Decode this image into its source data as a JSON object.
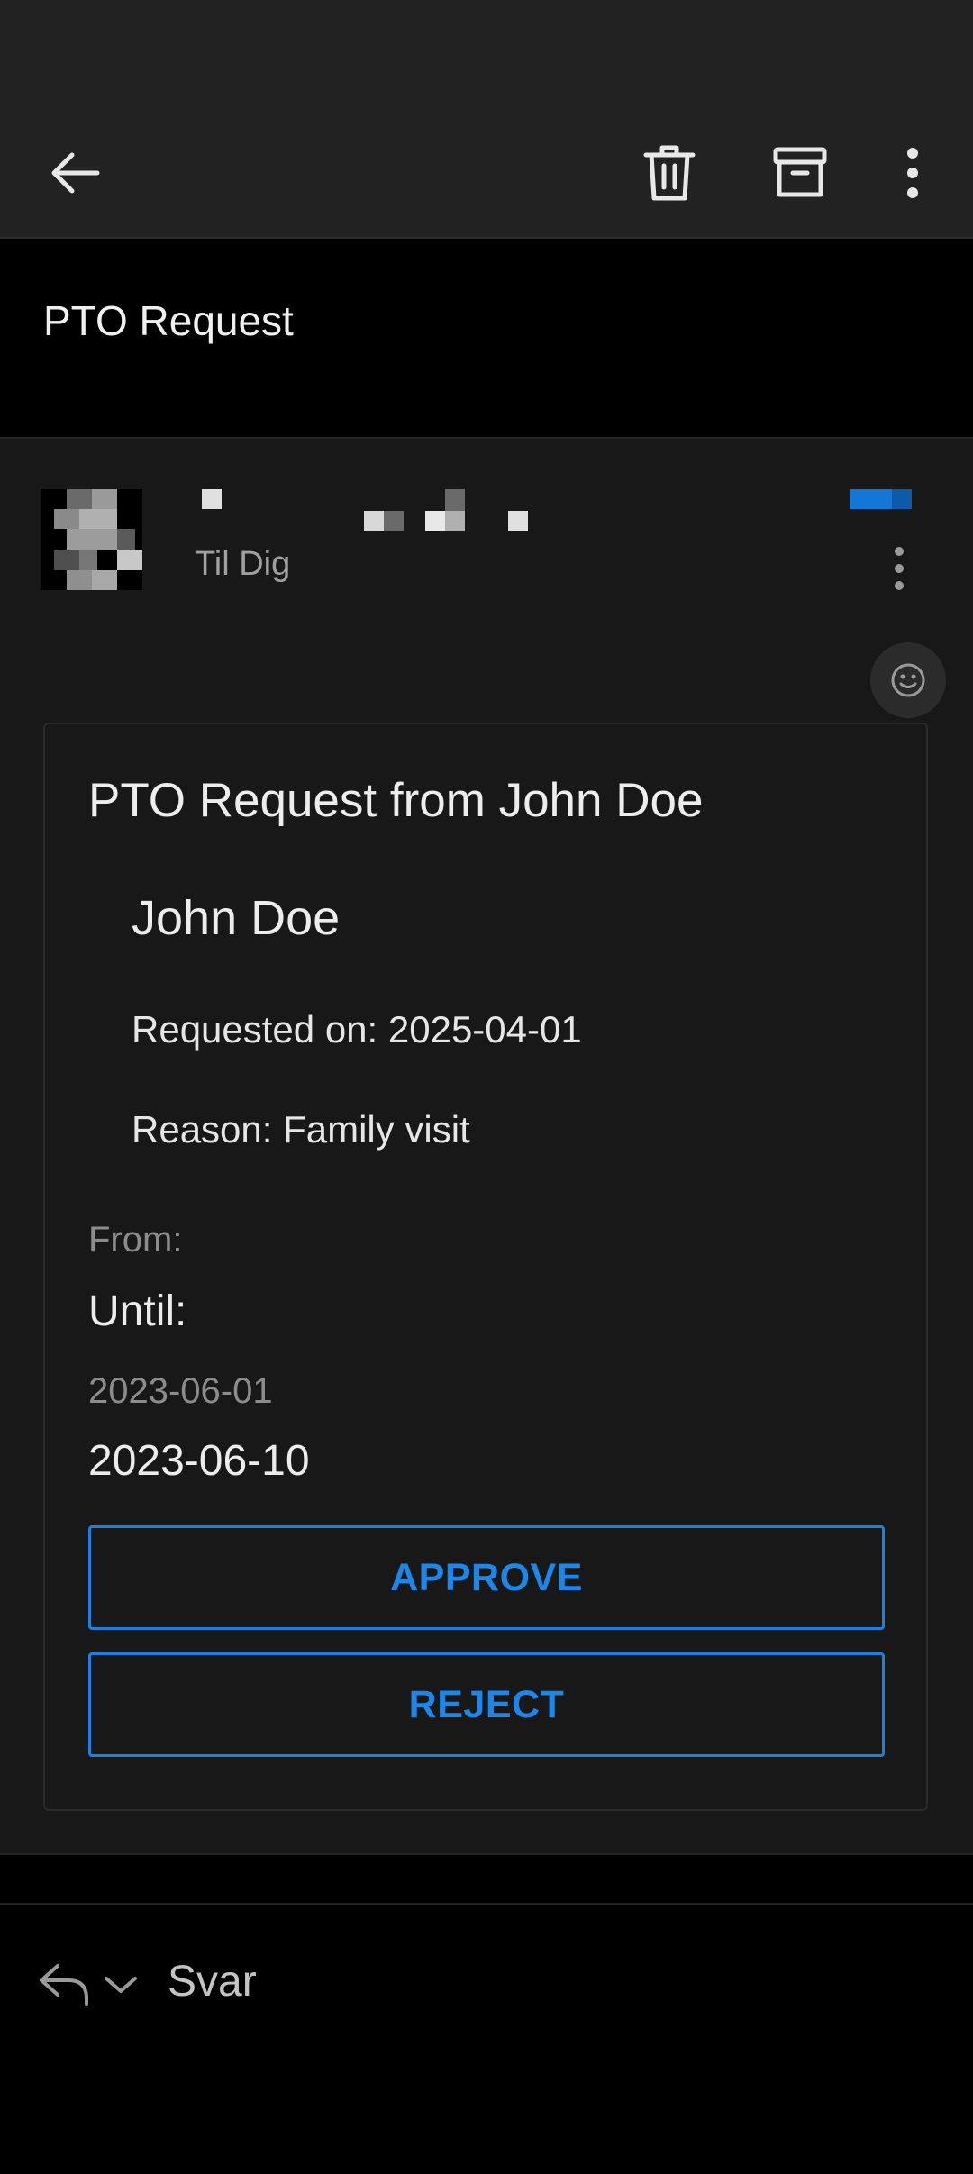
{
  "email": {
    "subject": "PTO Request",
    "recipient": "Til Dig"
  },
  "card": {
    "title": "PTO Request from John Doe",
    "employee_name": "John Doe",
    "requested_on": "Requested on: 2025-04-01",
    "reason": "Reason: Family visit",
    "from_label": "From:",
    "until_label": "Until:",
    "from_date": "2023-06-01",
    "until_date": "2023-06-10",
    "approve_label": "APPROVE",
    "reject_label": "REJECT"
  },
  "reply": {
    "label": "Svar"
  },
  "colors": {
    "accent": "#1c86ea",
    "flag": "#1377d8",
    "background": "#181818",
    "toolbar": "#222222"
  },
  "icons": {
    "back": "arrow-left-icon",
    "delete": "trash-icon",
    "archive": "archive-icon",
    "more": "more-vertical-icon",
    "reaction": "smiley-icon",
    "reply": "reply-icon"
  }
}
